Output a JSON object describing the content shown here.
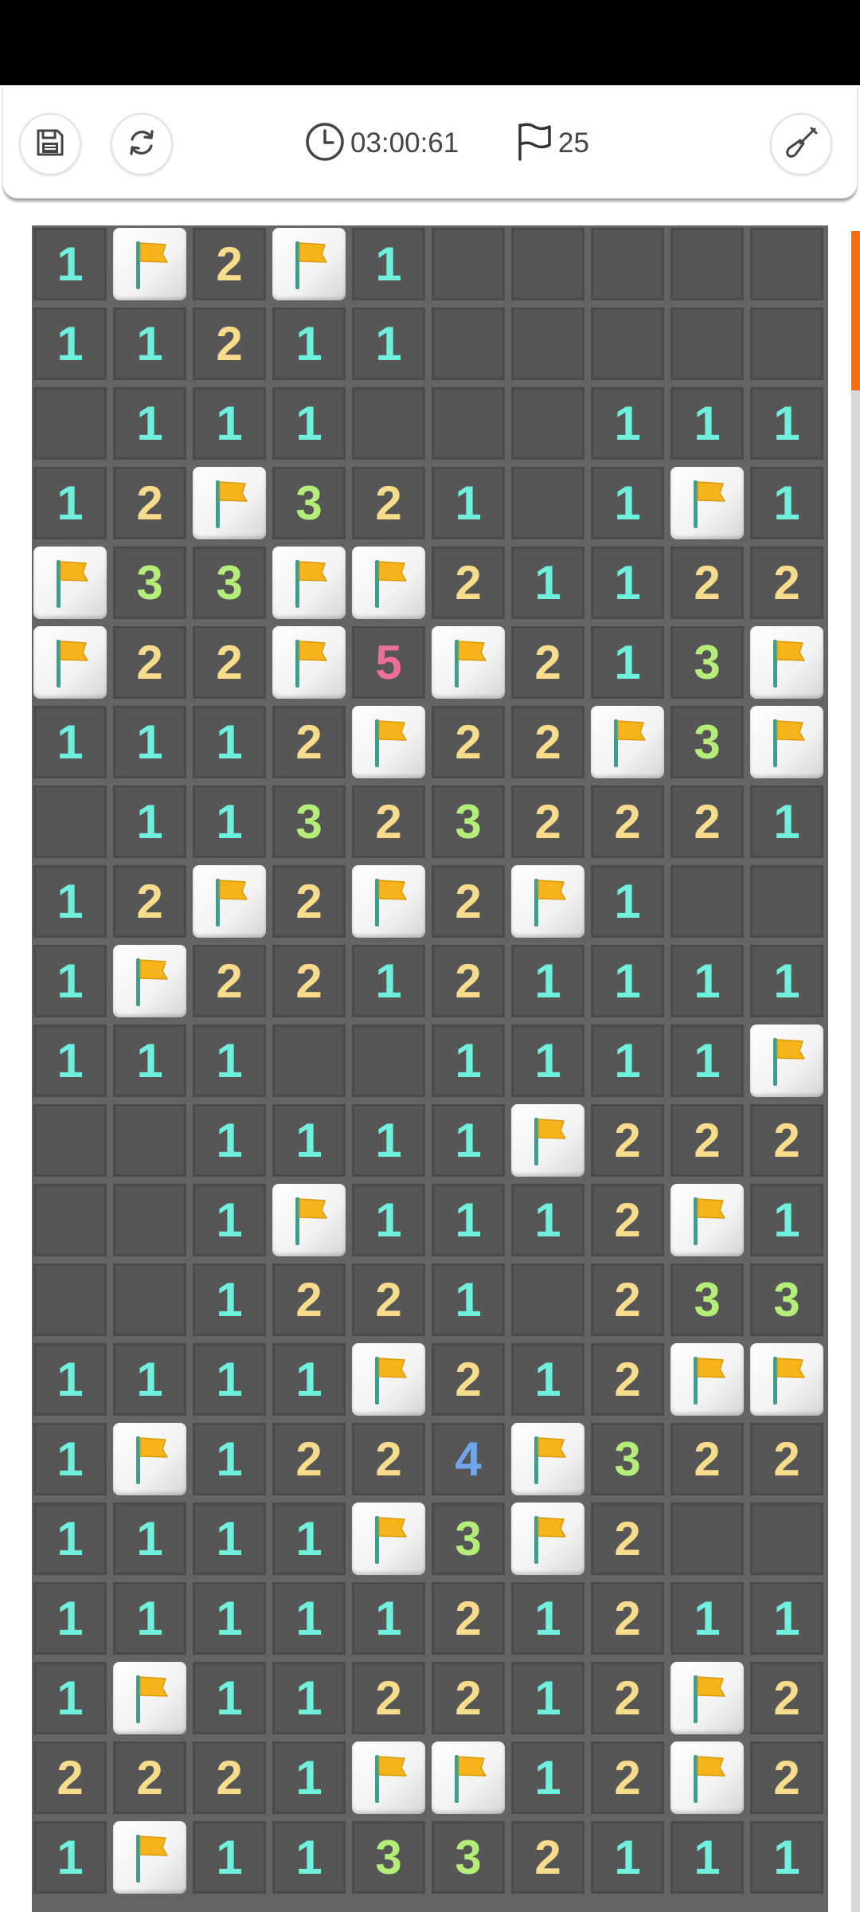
{
  "toolbar": {
    "timer": "03:00:61",
    "flag_count": "25",
    "icons": {
      "save": "save-icon",
      "restart": "restart-icon",
      "timer": "clock-icon",
      "flags": "flag-outline-icon",
      "tool": "shovel-icon"
    }
  },
  "board": {
    "rows": 21,
    "cols": 10,
    "legend": "F = flagged cell, 0 = revealed empty cell, 1-8 = adjacent mine count",
    "cells": [
      [
        "1",
        "F",
        "2",
        "F",
        "1",
        "0",
        "0",
        "0",
        "0",
        "0"
      ],
      [
        "1",
        "1",
        "2",
        "1",
        "1",
        "0",
        "0",
        "0",
        "0",
        "0"
      ],
      [
        "0",
        "1",
        "1",
        "1",
        "0",
        "0",
        "0",
        "1",
        "1",
        "1"
      ],
      [
        "1",
        "2",
        "F",
        "3",
        "2",
        "1",
        "0",
        "1",
        "F",
        "1"
      ],
      [
        "F",
        "3",
        "3",
        "F",
        "F",
        "2",
        "1",
        "1",
        "2",
        "2"
      ],
      [
        "F",
        "2",
        "2",
        "F",
        "5",
        "F",
        "2",
        "1",
        "3",
        "F"
      ],
      [
        "1",
        "1",
        "1",
        "2",
        "F",
        "2",
        "2",
        "F",
        "3",
        "F"
      ],
      [
        "0",
        "1",
        "1",
        "3",
        "2",
        "3",
        "2",
        "2",
        "2",
        "1"
      ],
      [
        "1",
        "2",
        "F",
        "2",
        "F",
        "2",
        "F",
        "1",
        "0",
        "0"
      ],
      [
        "1",
        "F",
        "2",
        "2",
        "1",
        "2",
        "1",
        "1",
        "1",
        "1"
      ],
      [
        "1",
        "1",
        "1",
        "0",
        "0",
        "1",
        "1",
        "1",
        "1",
        "F"
      ],
      [
        "0",
        "0",
        "1",
        "1",
        "1",
        "1",
        "F",
        "2",
        "2",
        "2"
      ],
      [
        "0",
        "0",
        "1",
        "F",
        "1",
        "1",
        "1",
        "2",
        "F",
        "1"
      ],
      [
        "0",
        "0",
        "1",
        "2",
        "2",
        "1",
        "0",
        "2",
        "3",
        "3"
      ],
      [
        "1",
        "1",
        "1",
        "1",
        "F",
        "2",
        "1",
        "2",
        "F",
        "F"
      ],
      [
        "1",
        "F",
        "1",
        "2",
        "2",
        "4",
        "F",
        "3",
        "2",
        "2"
      ],
      [
        "1",
        "1",
        "1",
        "1",
        "F",
        "3",
        "F",
        "2",
        "0",
        "0"
      ],
      [
        "1",
        "1",
        "1",
        "1",
        "1",
        "2",
        "1",
        "2",
        "1",
        "1"
      ],
      [
        "1",
        "F",
        "1",
        "1",
        "2",
        "2",
        "1",
        "2",
        "F",
        "2"
      ],
      [
        "2",
        "2",
        "2",
        "1",
        "F",
        "F",
        "1",
        "2",
        "F",
        "2"
      ],
      [
        "1",
        "F",
        "1",
        "1",
        "3",
        "3",
        "2",
        "1",
        "1",
        "1"
      ]
    ],
    "number_colors": {
      "1": "#6ff0dd",
      "2": "#f7dc8c",
      "3": "#b4ee78",
      "4": "#6fa6ee",
      "5": "#ee6f96"
    },
    "flag_color": "#f6b31a",
    "pole_color": "#3aa08e"
  },
  "scrollbar": {
    "accent": "#ff6a0d",
    "position_fraction": 0
  }
}
